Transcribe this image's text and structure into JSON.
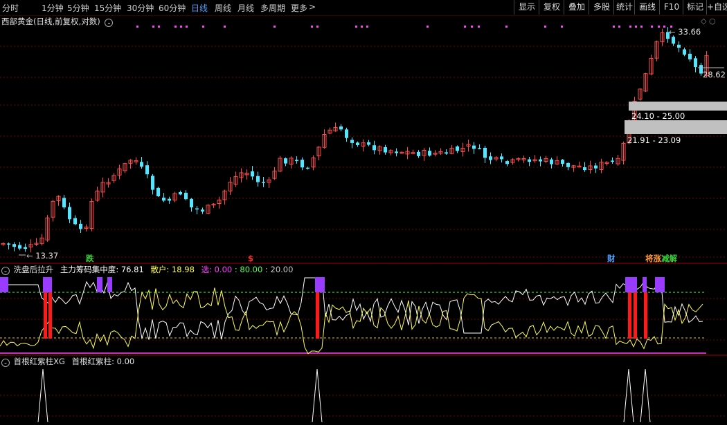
{
  "toolbar": {
    "periods": [
      {
        "label": "分时",
        "active": false
      },
      {
        "label": "1分钟",
        "active": false
      },
      {
        "label": "5分钟",
        "active": false
      },
      {
        "label": "15分钟",
        "active": false
      },
      {
        "label": "30分钟",
        "active": false
      },
      {
        "label": "60分钟",
        "active": false
      },
      {
        "label": "日线",
        "active": true
      },
      {
        "label": "周线",
        "active": false
      },
      {
        "label": "月线",
        "active": false
      },
      {
        "label": "多周期",
        "active": false
      },
      {
        "label": "更多",
        "active": false
      }
    ],
    "more_arrow": ">",
    "tools": [
      "显示",
      "复权",
      "叠加",
      "多股",
      "统计",
      "画线",
      "F10",
      "标记",
      "+自选"
    ]
  },
  "main_chart": {
    "title": "西部黄金(日线,前复权,对数)",
    "high_label": "33.66",
    "low_label": "13.37",
    "last_label": "28.62",
    "zones": [
      {
        "label": "24.10 - 25.00"
      },
      {
        "label": "21.91 - 23.09"
      }
    ],
    "events": [
      {
        "label": "跌",
        "color": "#3cd23c"
      },
      {
        "label": "$",
        "color": "#ff3030"
      },
      {
        "label": "财",
        "color": "#4aa3ff"
      },
      {
        "label": "将涨",
        "color": "#ff9a3c"
      },
      {
        "label": "减解",
        "color": "#3cd23c"
      }
    ]
  },
  "indicator1": {
    "name": "洗盘后拉升",
    "items": [
      {
        "label": "主力筹码集中度",
        "value": "76.81",
        "color": "#ffffff"
      },
      {
        "label": "散户",
        "value": "18.98",
        "color": "#ffff55"
      },
      {
        "label": "选",
        "value": "0.00",
        "color": "#ff40ff"
      },
      {
        "label": "",
        "value": "80.00",
        "color": "#55ff55"
      },
      {
        "label": "",
        "value": "20.00",
        "color": "#c8c8c8"
      }
    ]
  },
  "indicator2": {
    "name": "首根红紫柱XG",
    "item_label": "首根红紫柱",
    "item_value": "0.00"
  },
  "colors": {
    "up": "#ff4d4d",
    "down": "#55e6ff",
    "grid": "#7a0000",
    "accent": "#4aa3ff"
  }
}
